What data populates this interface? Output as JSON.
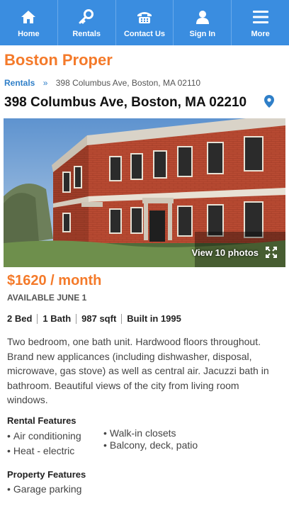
{
  "nav": {
    "items": [
      {
        "label": "Home",
        "icon": "home-icon"
      },
      {
        "label": "Rentals",
        "icon": "key-icon"
      },
      {
        "label": "Contact Us",
        "icon": "phone-icon"
      },
      {
        "label": "Sign In",
        "icon": "user-icon"
      },
      {
        "label": "More",
        "icon": "menu-icon"
      }
    ]
  },
  "colors": {
    "nav_bg": "#3a8de0",
    "accent": "#f47a2a",
    "link": "#2f7fc8"
  },
  "brand": "Boston Proper",
  "breadcrumb": {
    "link": "Rentals",
    "separator": "»",
    "current": "398 Columbus Ave, Boston, MA 02110"
  },
  "listing": {
    "title": "398 Columbus Ave, Boston, MA 02210",
    "photos_label": "View 10 photos",
    "price": "$1620 / month",
    "availability": "AVAILABLE JUNE 1",
    "specs": [
      "2 Bed",
      "1 Bath",
      "987 sqft",
      "Built in 1995"
    ],
    "description": "Two bedroom, one bath unit. Hardwood floors throughout. Brand new applicances (including dishwasher, disposal, microwave, gas stove) as well as central air. Jacuzzi bath in bathroom. Beautiful views of the city from living room windows."
  },
  "rental_features": {
    "title": "Rental Features",
    "col1": [
      "Air conditioning",
      "Heat - electric"
    ],
    "col2": [
      "Walk-in closets",
      "Balcony, deck, patio"
    ]
  },
  "property_features": {
    "title": "Property Features",
    "items": [
      "Garage parking"
    ]
  }
}
